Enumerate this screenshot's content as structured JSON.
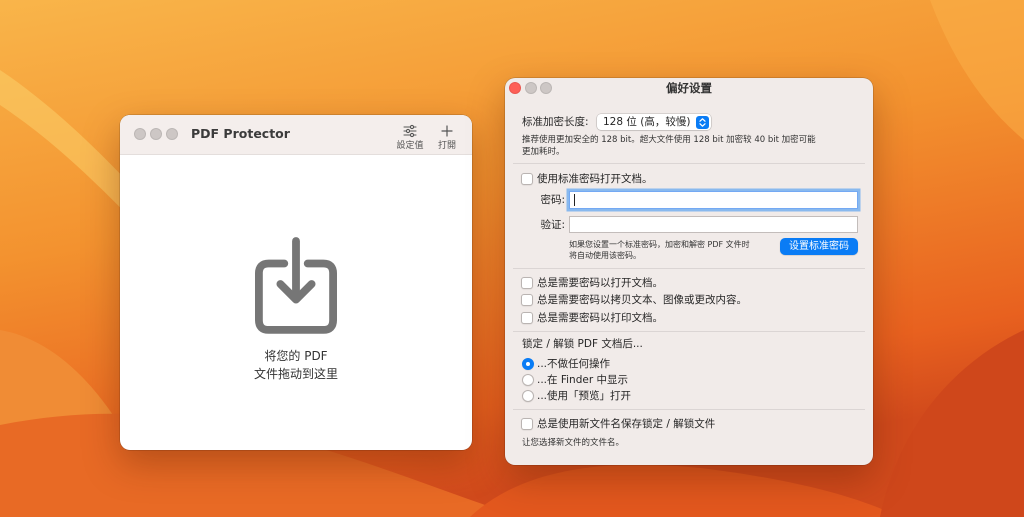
{
  "theme": {
    "accent": "#0a7cf5",
    "close_light": "#fe5f57",
    "inactive_light": "#cdc7c5",
    "window_bg": "#f1ebe9"
  },
  "desktop": {
    "colors": [
      "#f9b54a",
      "#f3922f",
      "#e8611f",
      "#d14a1c"
    ]
  },
  "main_window": {
    "title": "PDF Protector",
    "active": false,
    "toolbar": {
      "settings": {
        "label": "設定值",
        "icon": "sliders-icon"
      },
      "open": {
        "label": "打開",
        "icon": "plus-icon"
      }
    },
    "drop_zone": {
      "icon": "download-tray-icon",
      "lines": [
        "将您的 PDF",
        "文件拖动到这里"
      ]
    }
  },
  "preferences_window": {
    "title": "偏好设置",
    "active": true,
    "encryption": {
      "label": "标准加密长度:",
      "selected": "128 位 (高，较慢)",
      "description": [
        "推荐使用更加安全的 128 bit。超大文件使用 128 bit 加密较 40 bit 加密可能",
        "更加耗时。"
      ]
    },
    "standard_password": {
      "checkbox": {
        "label": "使用标准密码打开文档。",
        "checked": false
      },
      "password": {
        "label": "密码:",
        "value": ""
      },
      "verify": {
        "label": "验证:",
        "value": ""
      },
      "hint": [
        "如果您设置一个标准密码，加密和解密 PDF 文件时",
        "将自动使用该密码。"
      ],
      "button": "设置标准密码"
    },
    "require": [
      {
        "label": "总是需要密码以打开文档。",
        "checked": false
      },
      {
        "label": "总是需要密码以拷贝文本、图像或更改内容。",
        "checked": false
      },
      {
        "label": "总是需要密码以打印文档。",
        "checked": false
      }
    ],
    "after_lock": {
      "label": "锁定 / 解锁 PDF 文档后...",
      "options": [
        {
          "label": "...不做任何操作",
          "selected": true
        },
        {
          "label": "...在 Finder 中显示",
          "selected": false
        },
        {
          "label": "...使用「预览」打开",
          "selected": false
        }
      ]
    },
    "new_filename": {
      "label": "总是使用新文件名保存锁定 / 解锁文件",
      "checked": false,
      "note": "让您选择新文件的文件名。"
    }
  }
}
